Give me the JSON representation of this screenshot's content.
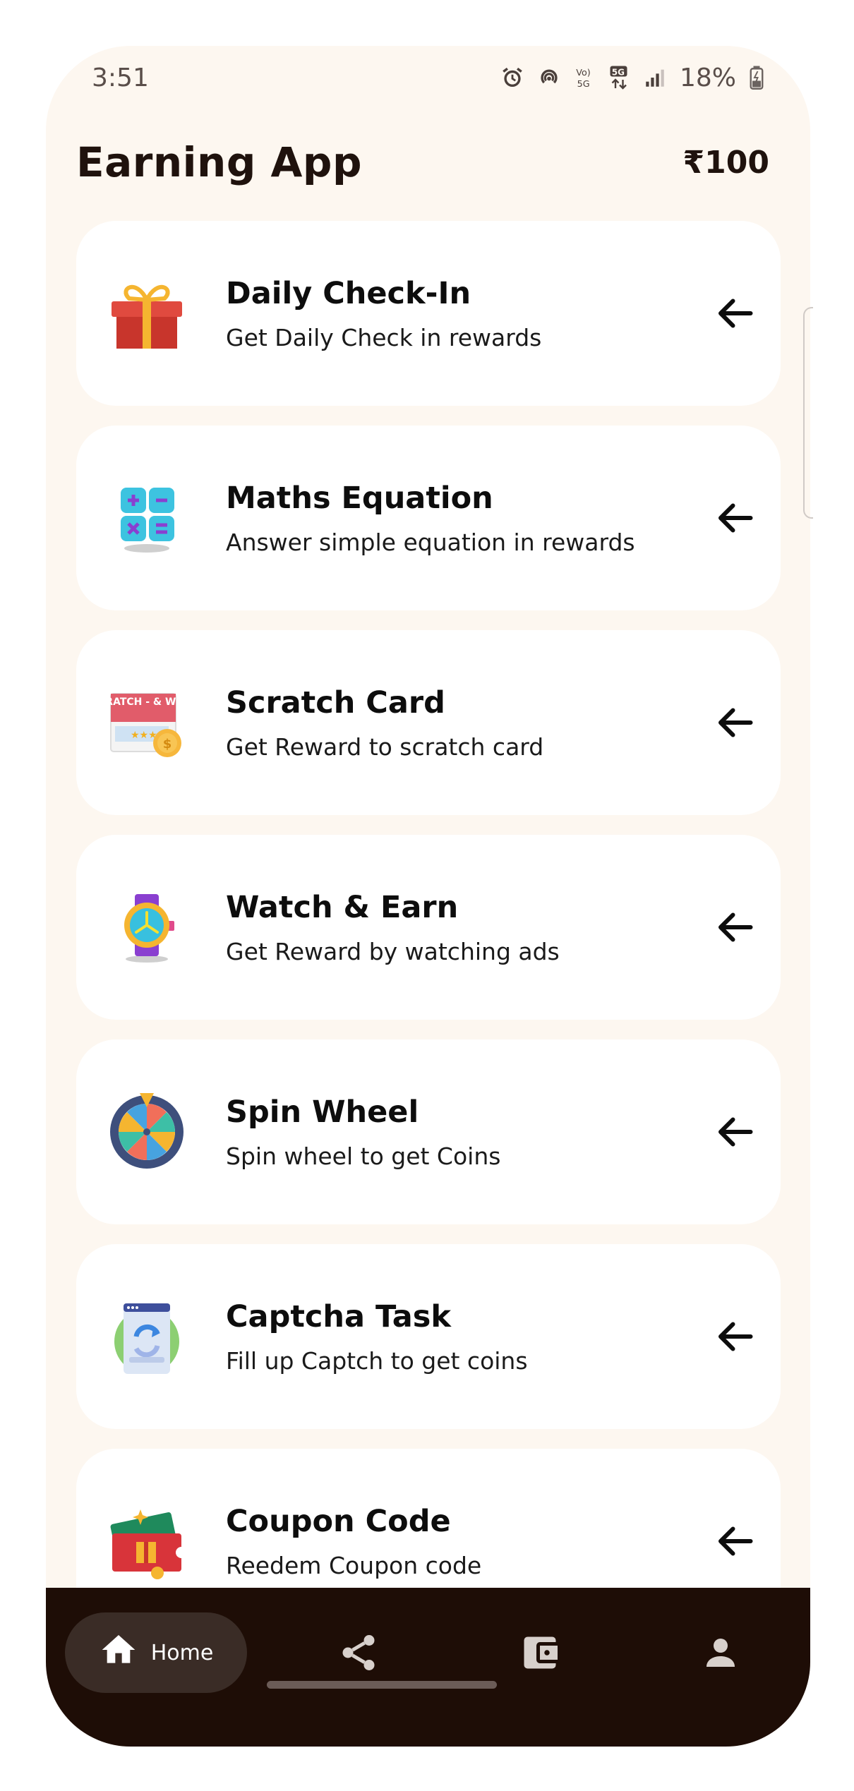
{
  "status": {
    "time": "3:51",
    "battery": "18%"
  },
  "app": {
    "title": "Earning App",
    "balance": "₹100"
  },
  "tasks": [
    {
      "title": "Daily Check-In",
      "subtitle": "Get Daily Check in rewards",
      "icon": "gift-icon"
    },
    {
      "title": "Maths Equation",
      "subtitle": "Answer simple equation in rewards",
      "icon": "calculator-icon"
    },
    {
      "title": "Scratch Card",
      "subtitle": "Get Reward to scratch card",
      "icon": "scratch-card-icon"
    },
    {
      "title": "Watch & Earn",
      "subtitle": "Get Reward by watching ads",
      "icon": "watch-icon"
    },
    {
      "title": "Spin Wheel",
      "subtitle": "Spin wheel to get Coins",
      "icon": "spin-wheel-icon"
    },
    {
      "title": "Captcha Task",
      "subtitle": "Fill up Captch to get coins",
      "icon": "captcha-icon"
    },
    {
      "title": "Coupon Code",
      "subtitle": "Reedem Coupon code",
      "icon": "coupon-icon"
    }
  ],
  "scratch_icon_text": "SCRATCH - & WIN -",
  "nav": {
    "items": [
      {
        "label": "Home",
        "icon": "home-icon",
        "active": true
      },
      {
        "label": "",
        "icon": "share-icon",
        "active": false
      },
      {
        "label": "",
        "icon": "wallet-icon",
        "active": false
      },
      {
        "label": "",
        "icon": "person-icon",
        "active": false
      }
    ]
  },
  "colors": {
    "background": "#fdf7f0",
    "card": "#ffffff",
    "navbar": "#1e0d06",
    "nav_active_pill": "#3a2c26",
    "text_primary": "#1f120d"
  }
}
